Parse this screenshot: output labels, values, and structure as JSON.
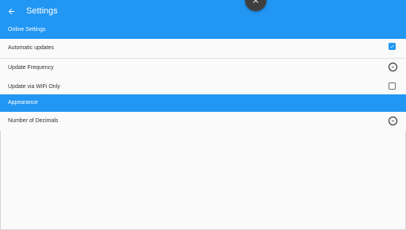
{
  "window": {
    "title": "Settings"
  },
  "icons": {
    "back": "arrow-left-icon",
    "fab": "close-icon",
    "checked": "checkbox-checked-icon",
    "unchecked": "checkbox-unchecked-icon",
    "dropdown": "chevron-down-circle-icon"
  },
  "colors": {
    "accent": "#2196f3",
    "fab": "#3f3f3f",
    "background": "#fafafa"
  },
  "sections": [
    {
      "header": "Online Settings",
      "rows": [
        {
          "label": "Automatic updates",
          "control": "checkbox",
          "checked": true
        },
        {
          "label": "Update Frequency",
          "control": "dropdown"
        },
        {
          "label": "Update via WiFi Only",
          "control": "checkbox",
          "checked": false
        }
      ]
    },
    {
      "header": "Appearance",
      "rows": [
        {
          "label": "Number of Decimals",
          "control": "dropdown"
        }
      ]
    }
  ]
}
